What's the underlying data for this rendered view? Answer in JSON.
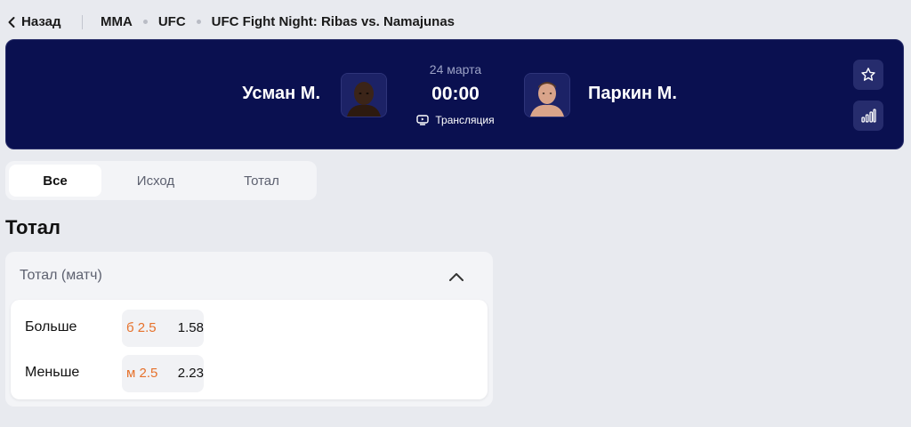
{
  "nav": {
    "back_label": "Назад",
    "breadcrumbs": [
      "MMA",
      "UFC",
      "UFC Fight Night: Ribas vs. Namajunas"
    ]
  },
  "match": {
    "home_name": "Усман М.",
    "away_name": "Паркин М.",
    "date": "24 марта",
    "time": "00:00",
    "stream_label": "Трансляция",
    "bg_color": "#0a1050",
    "icons": [
      "star-icon",
      "stats-icon",
      "tv-icon"
    ]
  },
  "tabs": [
    "Все",
    "Исход",
    "Тотал"
  ],
  "active_tab": "Все",
  "section_title": "Тотал",
  "market": {
    "title": "Тотал (матч)",
    "outcomes": [
      {
        "label": "Больше",
        "param": "б 2.5",
        "odd": "1.58"
      },
      {
        "label": "Меньше",
        "param": "м 2.5",
        "odd": "2.23"
      }
    ]
  },
  "accent_color": "#e6712b"
}
